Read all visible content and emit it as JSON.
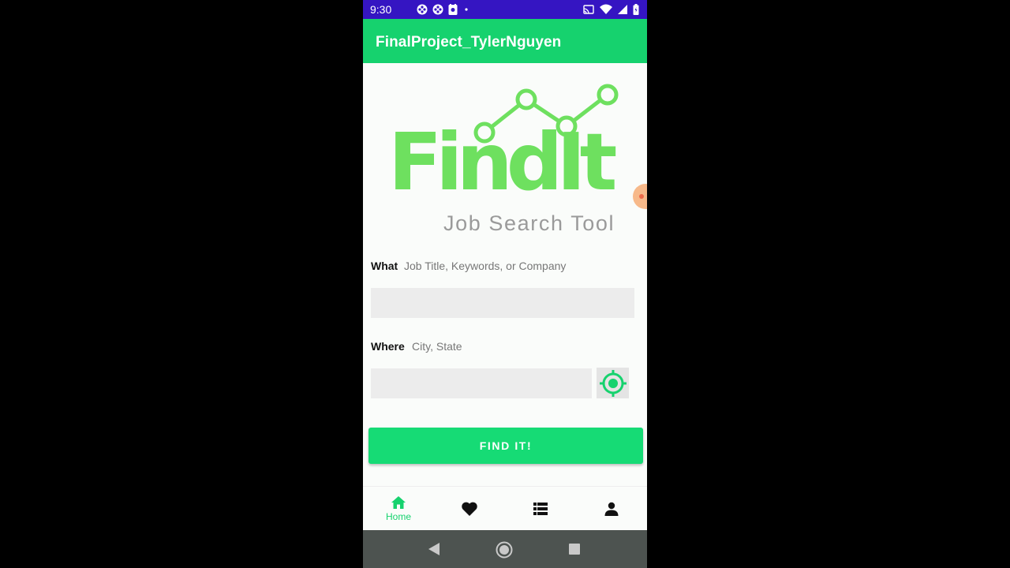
{
  "status_bar": {
    "time": "9:30",
    "notification_icons": [
      "game-controller-icon",
      "game-controller-icon",
      "badge-app-icon",
      "dot-icon"
    ],
    "system_icons": [
      "cast-icon",
      "wifi-icon",
      "signal-icon",
      "battery-icon"
    ]
  },
  "app_bar": {
    "title": "FinalProject_TylerNguyen"
  },
  "logo": {
    "name": "FindIt",
    "tagline": "Job Search Tool"
  },
  "form": {
    "what_label": "What",
    "what_hint": "Job Title, Keywords, or Company",
    "what_value": "",
    "where_label": "Where",
    "where_hint": "City, State",
    "where_value": "",
    "locate_icon": "my-location-icon",
    "submit_label": "FIND IT!"
  },
  "bottom_nav": {
    "items": [
      {
        "id": "home",
        "label": "Home",
        "icon": "home-icon",
        "active": true
      },
      {
        "id": "favorites",
        "label": "",
        "icon": "heart-icon",
        "active": false
      },
      {
        "id": "list",
        "label": "",
        "icon": "list-icon",
        "active": false
      },
      {
        "id": "profile",
        "label": "",
        "icon": "person-icon",
        "active": false
      }
    ]
  },
  "colors": {
    "primary": "#16d26e",
    "status_bar": "#3515c2",
    "logo_green": "#6ee05f",
    "system_nav": "#4d5350"
  }
}
